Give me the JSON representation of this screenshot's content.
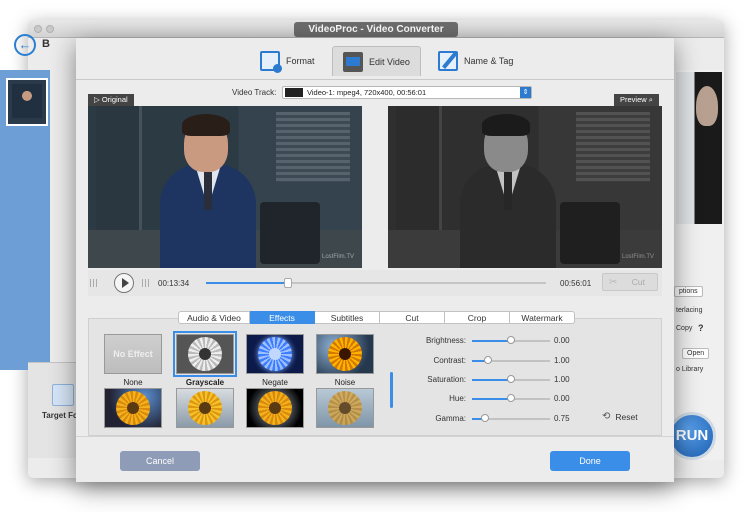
{
  "main_window": {
    "title": "VideoProc - Video Converter",
    "back_label": "B",
    "target_format_label": "Target Fo",
    "right_panel": {
      "options_label": "ptions",
      "interlacing_label": "terlacing",
      "copy_label": "Copy",
      "help_label": "?",
      "open_button": "Open",
      "library_label": "o Library",
      "run_button": "RUN"
    }
  },
  "dialog": {
    "tabs": [
      {
        "label": "Format",
        "icon": "format-icon"
      },
      {
        "label": "Edit Video",
        "icon": "edit-video-icon",
        "active": true
      },
      {
        "label": "Name & Tag",
        "icon": "name-tag-icon"
      }
    ],
    "video_track": {
      "label": "Video Track:",
      "value": "Video-1: mpeg4, 720x400, 00:56:01"
    },
    "original_badge": "▷ Original",
    "preview_badge": "Preview",
    "watermark": "LostFilm.TV",
    "player": {
      "current_time": "00:13:34",
      "total_time": "00:56:01",
      "progress": 0.24,
      "cut_button": "Cut"
    },
    "subtabs": [
      "Audio & Video",
      "Effects",
      "Subtitles",
      "Cut",
      "Crop",
      "Watermark"
    ],
    "active_subtab": "Effects",
    "effects": [
      {
        "label": "None",
        "thumb_text": "No Effect"
      },
      {
        "label": "Grayscale",
        "selected": true
      },
      {
        "label": "Negate"
      },
      {
        "label": "Noise"
      },
      {
        "label": ""
      },
      {
        "label": ""
      },
      {
        "label": ""
      },
      {
        "label": ""
      }
    ],
    "adjustments": [
      {
        "label": "Brightness:",
        "value": "0.00",
        "position": 0.5
      },
      {
        "label": "Contrast:",
        "value": "1.00",
        "position": 0.2
      },
      {
        "label": "Saturation:",
        "value": "1.00",
        "position": 0.5
      },
      {
        "label": "Hue:",
        "value": "0.00",
        "position": 0.5
      },
      {
        "label": "Gamma:",
        "value": "0.75",
        "position": 0.17
      }
    ],
    "reset_button": "Reset",
    "cancel_button": "Cancel",
    "done_button": "Done"
  },
  "colors": {
    "accent": "#3a8ee8",
    "cancel": "#8e9cb7"
  }
}
